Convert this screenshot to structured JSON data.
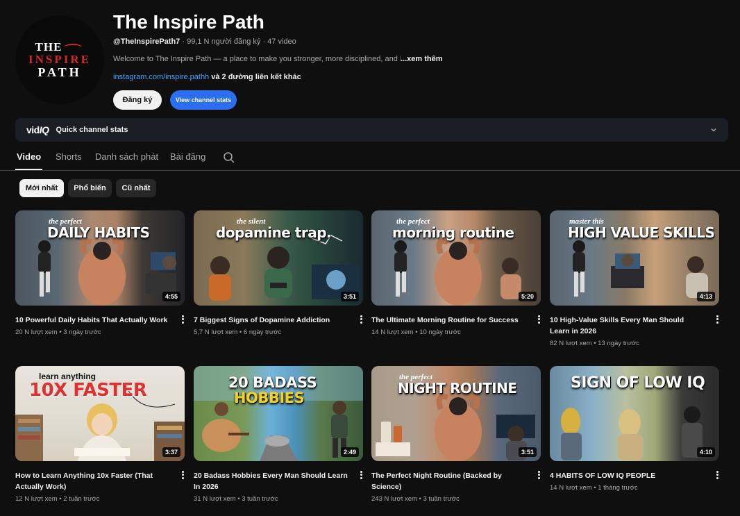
{
  "channel": {
    "avatar_text": [
      "THE",
      "INSPIRE",
      "PATH"
    ],
    "title": "The Inspire Path",
    "handle": "@TheInspirePath7",
    "stats": " · 99,1 N người đăng ký · 47 video",
    "description": "Welcome to The Inspire Path — a place to make you stronger, more disciplined, and l",
    "more_label": "...xem thêm",
    "link": "instagram.com/inspire.pathh",
    "more_links": " và 2 đường liên kết khác",
    "subscribe_label": "Đăng ký",
    "stats_button_label": "View channel stats"
  },
  "vidiq": {
    "logo_vid": "vid",
    "logo_iq": "IQ",
    "title": "Quick channel stats"
  },
  "tabs": [
    {
      "label": "Video",
      "active": true
    },
    {
      "label": "Shorts",
      "active": false
    },
    {
      "label": "Danh sách phát",
      "active": false
    },
    {
      "label": "Bài đăng",
      "active": false
    }
  ],
  "chips": [
    {
      "label": "Mới nhất",
      "active": true
    },
    {
      "label": "Phổ biến",
      "active": false
    },
    {
      "label": "Cũ nhất",
      "active": false
    }
  ],
  "videos": [
    {
      "title": "10 Powerful Daily Habits That Actually Work",
      "views": "20 N lượt xem",
      "age": "3 ngày trước",
      "duration": "4:55",
      "thumb_small": "the perfect",
      "thumb_big": "DAILY HABITS"
    },
    {
      "title": "7 Biggest Signs of Dopamine Addiction",
      "views": "5,7 N lượt xem",
      "age": "6 ngày trước",
      "duration": "3:51",
      "thumb_small": "the silent",
      "thumb_big": "dopamine trap."
    },
    {
      "title": "The Ultimate Morning Routine for Success",
      "views": "14 N lượt xem",
      "age": "10 ngày trước",
      "duration": "5:20",
      "thumb_small": "the perfect",
      "thumb_big": "morning routine"
    },
    {
      "title": "10 High-Value Skills Every Man Should Learn in 2026",
      "views": "82 N lượt xem",
      "age": "13 ngày trước",
      "duration": "4:13",
      "thumb_small": "master this",
      "thumb_big": "HIGH VALUE SKILLS"
    },
    {
      "title": "How to Learn Anything 10x Faster (That Actually Work)",
      "views": "12 N lượt xem",
      "age": "2 tuần trước",
      "duration": "3:37",
      "thumb_small": "learn anything",
      "thumb_big": "10X FASTER"
    },
    {
      "title": "20 Badass Hobbies Every Man Should Learn In 2026",
      "views": "31 N lượt xem",
      "age": "3 tuần trước",
      "duration": "2:49",
      "thumb_small": "20 BADASS",
      "thumb_big": "HOBBIES"
    },
    {
      "title": "The Perfect Night Routine (Backed by Science)",
      "views": "243 N lượt xem",
      "age": "3 tuần trước",
      "duration": "3:51",
      "thumb_small": "the perfect",
      "thumb_big": "NIGHT ROUTINE"
    },
    {
      "title": "4 HABITS OF LOW IQ PEOPLE",
      "views": "14 N lượt xem",
      "age": "1 tháng trước",
      "duration": "4:10",
      "thumb_small": "",
      "thumb_big": "SIGN OF LOW IQ"
    }
  ],
  "colors": {
    "background": "#0f0f0f",
    "accent_blue": "#2b6ff0",
    "link_blue": "#3ea6ff",
    "brand_red": "#d4262b"
  }
}
